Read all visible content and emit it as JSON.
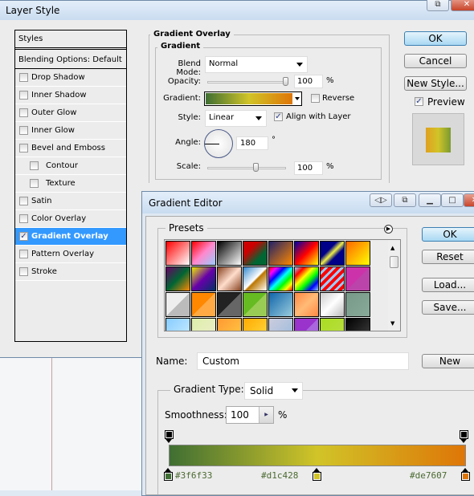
{
  "layer_style": {
    "title": "Layer Style",
    "styles_header": "Styles",
    "blending": "Blending Options: Default",
    "items": [
      {
        "label": "Drop Shadow",
        "checked": false,
        "sub": false
      },
      {
        "label": "Inner Shadow",
        "checked": false,
        "sub": false
      },
      {
        "label": "Outer Glow",
        "checked": false,
        "sub": false
      },
      {
        "label": "Inner Glow",
        "checked": false,
        "sub": false
      },
      {
        "label": "Bevel and Emboss",
        "checked": false,
        "sub": false
      },
      {
        "label": "Contour",
        "checked": false,
        "sub": true
      },
      {
        "label": "Texture",
        "checked": false,
        "sub": true
      },
      {
        "label": "Satin",
        "checked": false,
        "sub": false
      },
      {
        "label": "Color Overlay",
        "checked": false,
        "sub": false
      },
      {
        "label": "Gradient Overlay",
        "checked": true,
        "sub": false,
        "selected": true
      },
      {
        "label": "Pattern Overlay",
        "checked": false,
        "sub": false
      },
      {
        "label": "Stroke",
        "checked": false,
        "sub": false
      }
    ],
    "section_title": "Gradient Overlay",
    "group_title": "Gradient",
    "blend_mode_label": "Blend Mode:",
    "blend_mode": "Normal",
    "opacity_label": "Opacity:",
    "opacity": "100",
    "opacity_unit": "%",
    "gradient_label": "Gradient:",
    "reverse_label": "Reverse",
    "reverse": false,
    "style_label": "Style:",
    "style": "Linear",
    "align_label": "Align with Layer",
    "align": true,
    "angle_label": "Angle:",
    "angle": "180",
    "angle_unit": "°",
    "scale_label": "Scale:",
    "scale": "100",
    "scale_unit": "%",
    "ok": "OK",
    "cancel": "Cancel",
    "new_style": "New Style...",
    "preview_label": "Preview",
    "preview": true
  },
  "gradient_editor": {
    "title": "Gradient Editor",
    "presets_label": "Presets",
    "ok": "OK",
    "reset": "Reset",
    "load": "Load...",
    "save": "Save...",
    "name_label": "Name:",
    "name": "Custom",
    "new": "New",
    "type_label": "Gradient Type:",
    "type": "Solid",
    "smoothness_label": "Smoothness:",
    "smoothness": "100",
    "smoothness_unit": "%",
    "color_stops": [
      {
        "color": "#3f6f33",
        "location": 0,
        "label": "#3f6f33"
      },
      {
        "color": "#d1c428",
        "location": 50,
        "label": "#d1c428"
      },
      {
        "color": "#de7607",
        "location": 100,
        "label": "#de7607"
      }
    ],
    "opacity_stops": [
      0,
      100
    ]
  }
}
